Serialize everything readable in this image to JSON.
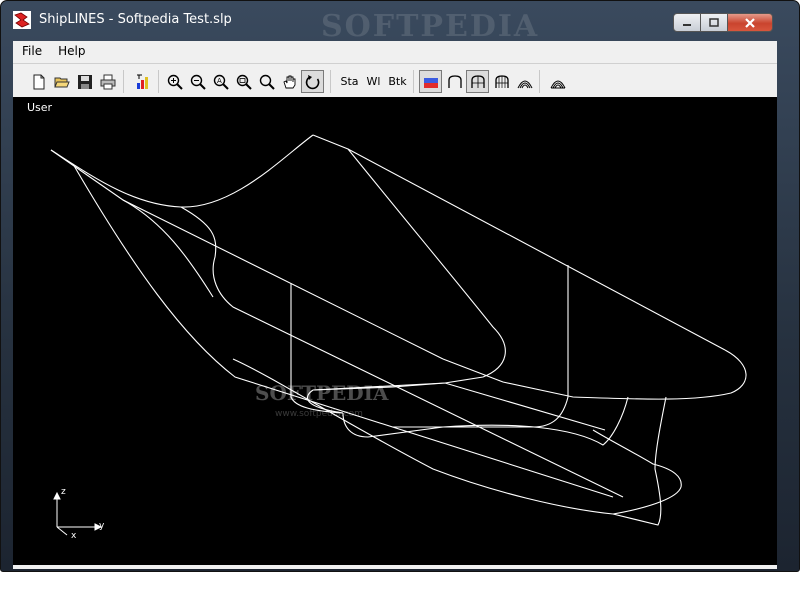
{
  "window": {
    "title": "ShipLINES - Softpedia Test.slp",
    "watermark": "SOFTPEDIA"
  },
  "menu": {
    "items": [
      {
        "label": "File"
      },
      {
        "label": "Help"
      }
    ]
  },
  "toolbar": {
    "buttons": [
      {
        "name": "new-file",
        "icon": "new-document-icon"
      },
      {
        "name": "open-file",
        "icon": "folder-open-icon"
      },
      {
        "name": "save-file",
        "icon": "floppy-disk-icon"
      },
      {
        "name": "print",
        "icon": "printer-icon"
      },
      {
        "name": "colors",
        "icon": "color-palette-icon"
      },
      {
        "name": "zoom-in",
        "icon": "zoom-in-icon"
      },
      {
        "name": "zoom-out",
        "icon": "zoom-out-icon"
      },
      {
        "name": "zoom-auto",
        "icon": "zoom-auto-icon"
      },
      {
        "name": "zoom-window",
        "icon": "zoom-window-icon"
      },
      {
        "name": "zoom",
        "icon": "magnifier-icon"
      },
      {
        "name": "pan",
        "icon": "hand-icon"
      },
      {
        "name": "rotate",
        "icon": "rotate-icon",
        "pressed": true
      },
      {
        "name": "stations",
        "label": "Sta"
      },
      {
        "name": "waterlines",
        "label": "Wl"
      },
      {
        "name": "buttocks",
        "label": "Btk"
      },
      {
        "name": "shaded-view",
        "icon": "shaded-hull-icon",
        "pressed": true
      },
      {
        "name": "body-plan",
        "icon": "body-plan-icon"
      },
      {
        "name": "body-plan-2",
        "icon": "body-plan-grid-icon",
        "pressed": true
      },
      {
        "name": "body-plan-3",
        "icon": "body-plan-grid-icon-2"
      },
      {
        "name": "lines-plan",
        "icon": "lines-plan-icon"
      },
      {
        "name": "lines-plan-2",
        "icon": "lines-plan-icon-2"
      }
    ]
  },
  "viewport": {
    "view_label": "User",
    "background": "#000000",
    "line_color": "#ffffff",
    "watermark": "SOFTPEDIA",
    "watermark_url": "www.softpedia.com",
    "axes": {
      "z": "z",
      "x": "x",
      "y": "y"
    }
  },
  "colors": {
    "titlebar": "#2f3b4b",
    "close_button": "#c9442e"
  }
}
